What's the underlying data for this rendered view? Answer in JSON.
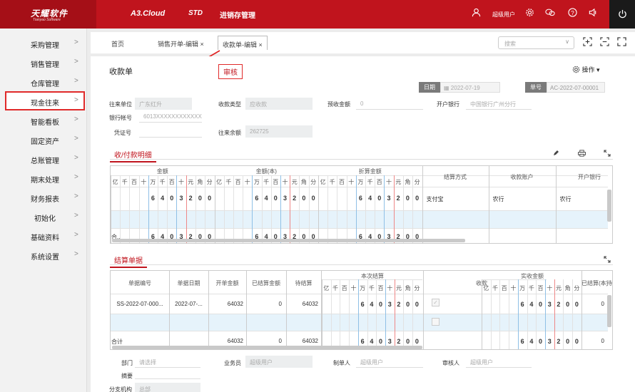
{
  "brand": {
    "name": "天耀软件",
    "sub": "Tianyao Software"
  },
  "topbar": {
    "product": "A3.Cloud",
    "edition": "STD",
    "module": "进销存管理",
    "user": "超级用户",
    "icons": [
      "user-icon",
      "gear-icon",
      "chat-icon",
      "help-icon",
      "notice-icon",
      "power-icon"
    ]
  },
  "sidebar": {
    "items": [
      {
        "label": "采购管理",
        "arrow": ">"
      },
      {
        "label": "销售管理",
        "arrow": ">"
      },
      {
        "label": "仓库管理",
        "arrow": ">"
      },
      {
        "label": "现金往来",
        "arrow": ">"
      },
      {
        "label": "智能看板",
        "arrow": ">"
      },
      {
        "label": "固定资产",
        "arrow": ">"
      },
      {
        "label": "总账管理",
        "arrow": ">"
      },
      {
        "label": "期末处理",
        "arrow": ">"
      },
      {
        "label": "财务报表",
        "arrow": ">"
      },
      {
        "label": "初始化",
        "arrow": ">"
      },
      {
        "label": "基础资料",
        "arrow": ">"
      },
      {
        "label": "系统设置",
        "arrow": ">"
      }
    ]
  },
  "tabs": {
    "home": "首页",
    "t1": "销售开单-编辑",
    "t2": "收款单-编辑",
    "close": "×"
  },
  "search": {
    "placeholder": "搜索",
    "arrow": "∨"
  },
  "form": {
    "title": "收款单",
    "status": "审核",
    "ops": "操作 ▾",
    "date_label": "日期",
    "date_value": "2022-07-19",
    "no_label": "单号",
    "no_value": "AC-2022-07-00001",
    "partner_label": "往来单位",
    "partner_value": "广东红升",
    "type_label": "收款类型",
    "type_value": "应收款",
    "prepay_label": "预收金额",
    "prepay_value": "0",
    "bank_label": "开户银行",
    "bank_value": "中国银行广州分行",
    "account_label": "银行帐号",
    "account_value": "6013XXXXXXXXXXXX",
    "voucher_label": "凭证号",
    "balance_label": "往来余额",
    "balance_value": "262725"
  },
  "detail": {
    "title": "收/付款明细",
    "groups": [
      "金额",
      "金额(本)",
      "折算金额"
    ],
    "digits": [
      "亿",
      "千",
      "百",
      "十",
      "万",
      "千",
      "百",
      "十",
      "元",
      "角",
      "分"
    ],
    "cols": [
      "结算方式",
      "收款账户",
      "开户银行"
    ],
    "row1": {
      "amount_digits": [
        "",
        "",
        "",
        "",
        "6",
        "4",
        "0",
        "3",
        "2",
        "0",
        "0"
      ],
      "method": "支付宝",
      "account": "农行",
      "bank": "农行"
    },
    "total_label": "合.."
  },
  "settle": {
    "title": "结算单据",
    "headers": [
      "单据编号",
      "单据日期",
      "开单金额",
      "已结算金额",
      "待结算"
    ],
    "group_now": "本次结算",
    "group_actual": "实收金额",
    "col_receive": "收款",
    "col_settled": "已结算(本)",
    "col_pending": "待结制",
    "digits": [
      "亿",
      "千",
      "百",
      "十",
      "万",
      "千",
      "百",
      "十",
      "元",
      "角",
      "分"
    ],
    "row1": {
      "no": "SS-2022-07-000...",
      "date": "2022-07-...",
      "amount": "64032",
      "settled": "0",
      "pending": "64032",
      "digits": [
        "",
        "",
        "",
        "",
        "6",
        "4",
        "0",
        "3",
        "2",
        "0",
        "0"
      ],
      "settled_local": "0",
      "check": "✓"
    },
    "total": {
      "label": "合计",
      "amount": "64032",
      "settled": "0",
      "pending": "64032",
      "digits": [
        "",
        "",
        "",
        "",
        "6",
        "4",
        "0",
        "3",
        "2",
        "0",
        "0"
      ],
      "settled_local": "0"
    }
  },
  "footer": {
    "dept_label": "部门",
    "dept_value": "请选择",
    "sales_label": "业务员",
    "sales_value": "超级用户",
    "maker_label": "制单人",
    "maker_value": "超级用户",
    "auditor_label": "审核人",
    "auditor_value": "超级用户",
    "memo_label": "摘要",
    "branch_label": "分支机构",
    "branch_value": "总部"
  }
}
